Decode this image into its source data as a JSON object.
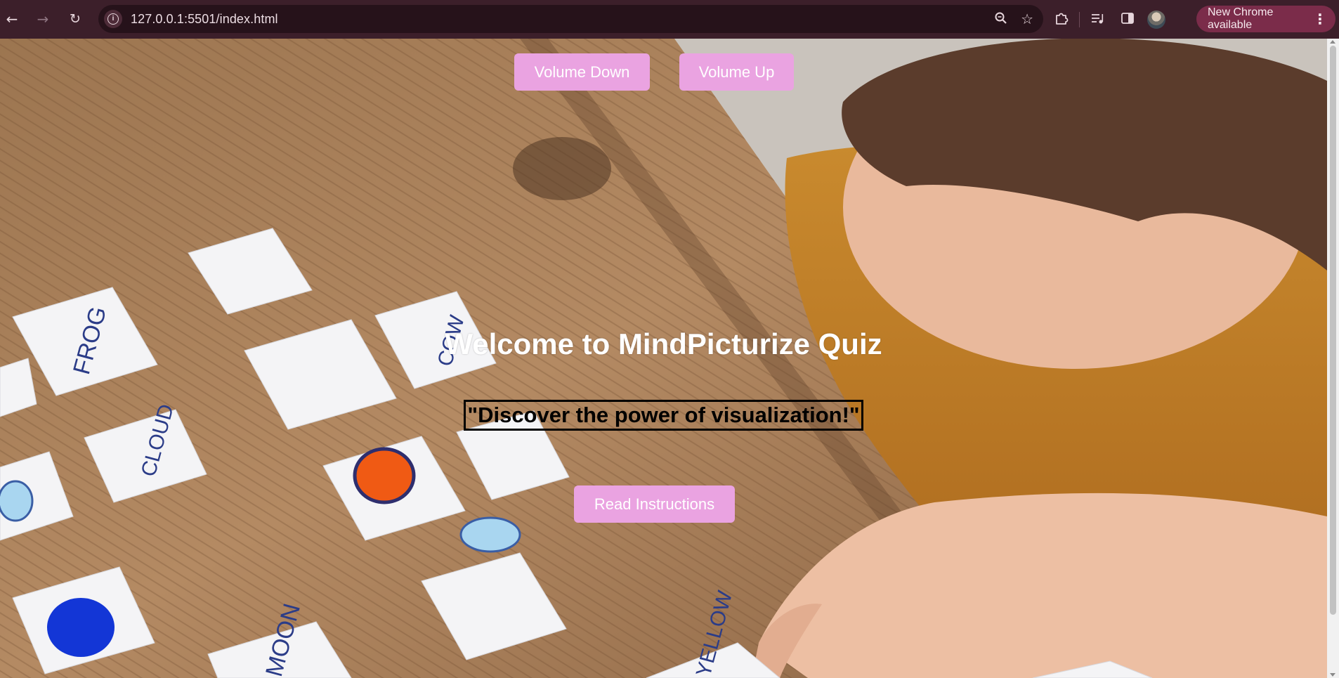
{
  "browser": {
    "url": "127.0.0.1:5501/index.html",
    "update_label": "New Chrome available",
    "icons": {
      "back": "back-arrow-icon",
      "forward": "forward-arrow-icon",
      "reload": "reload-icon",
      "site_info": "info-icon",
      "zoom": "zoom-icon",
      "bookmark": "star-icon",
      "extensions": "puzzle-icon",
      "media": "media-queue-icon",
      "side_panel": "side-panel-icon",
      "profile": "avatar",
      "menu": "kebab-menu-icon"
    }
  },
  "page": {
    "volume_down_label": "Volume Down",
    "volume_up_label": "Volume Up",
    "heading": "Welcome to MindPicturize Quiz",
    "tagline": "\"Discover the power of visualization!\"",
    "read_instructions_label": "Read Instructions",
    "colors": {
      "button_bg": "#eaa3e1",
      "button_text": "#ffffff",
      "heading_text": "#ffffff",
      "tagline_text": "#000000"
    }
  }
}
